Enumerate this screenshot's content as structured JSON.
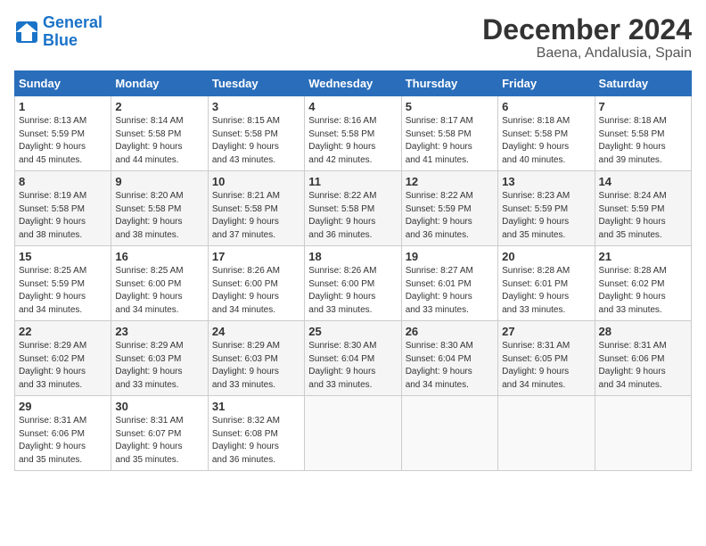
{
  "logo": {
    "line1": "General",
    "line2": "Blue"
  },
  "title": "December 2024",
  "subtitle": "Baena, Andalusia, Spain",
  "days_header": [
    "Sunday",
    "Monday",
    "Tuesday",
    "Wednesday",
    "Thursday",
    "Friday",
    "Saturday"
  ],
  "weeks": [
    [
      {
        "day": "1",
        "info": "Sunrise: 8:13 AM\nSunset: 5:59 PM\nDaylight: 9 hours\nand 45 minutes."
      },
      {
        "day": "2",
        "info": "Sunrise: 8:14 AM\nSunset: 5:58 PM\nDaylight: 9 hours\nand 44 minutes."
      },
      {
        "day": "3",
        "info": "Sunrise: 8:15 AM\nSunset: 5:58 PM\nDaylight: 9 hours\nand 43 minutes."
      },
      {
        "day": "4",
        "info": "Sunrise: 8:16 AM\nSunset: 5:58 PM\nDaylight: 9 hours\nand 42 minutes."
      },
      {
        "day": "5",
        "info": "Sunrise: 8:17 AM\nSunset: 5:58 PM\nDaylight: 9 hours\nand 41 minutes."
      },
      {
        "day": "6",
        "info": "Sunrise: 8:18 AM\nSunset: 5:58 PM\nDaylight: 9 hours\nand 40 minutes."
      },
      {
        "day": "7",
        "info": "Sunrise: 8:18 AM\nSunset: 5:58 PM\nDaylight: 9 hours\nand 39 minutes."
      }
    ],
    [
      {
        "day": "8",
        "info": "Sunrise: 8:19 AM\nSunset: 5:58 PM\nDaylight: 9 hours\nand 38 minutes."
      },
      {
        "day": "9",
        "info": "Sunrise: 8:20 AM\nSunset: 5:58 PM\nDaylight: 9 hours\nand 38 minutes."
      },
      {
        "day": "10",
        "info": "Sunrise: 8:21 AM\nSunset: 5:58 PM\nDaylight: 9 hours\nand 37 minutes."
      },
      {
        "day": "11",
        "info": "Sunrise: 8:22 AM\nSunset: 5:58 PM\nDaylight: 9 hours\nand 36 minutes."
      },
      {
        "day": "12",
        "info": "Sunrise: 8:22 AM\nSunset: 5:59 PM\nDaylight: 9 hours\nand 36 minutes."
      },
      {
        "day": "13",
        "info": "Sunrise: 8:23 AM\nSunset: 5:59 PM\nDaylight: 9 hours\nand 35 minutes."
      },
      {
        "day": "14",
        "info": "Sunrise: 8:24 AM\nSunset: 5:59 PM\nDaylight: 9 hours\nand 35 minutes."
      }
    ],
    [
      {
        "day": "15",
        "info": "Sunrise: 8:25 AM\nSunset: 5:59 PM\nDaylight: 9 hours\nand 34 minutes."
      },
      {
        "day": "16",
        "info": "Sunrise: 8:25 AM\nSunset: 6:00 PM\nDaylight: 9 hours\nand 34 minutes."
      },
      {
        "day": "17",
        "info": "Sunrise: 8:26 AM\nSunset: 6:00 PM\nDaylight: 9 hours\nand 34 minutes."
      },
      {
        "day": "18",
        "info": "Sunrise: 8:26 AM\nSunset: 6:00 PM\nDaylight: 9 hours\nand 33 minutes."
      },
      {
        "day": "19",
        "info": "Sunrise: 8:27 AM\nSunset: 6:01 PM\nDaylight: 9 hours\nand 33 minutes."
      },
      {
        "day": "20",
        "info": "Sunrise: 8:28 AM\nSunset: 6:01 PM\nDaylight: 9 hours\nand 33 minutes."
      },
      {
        "day": "21",
        "info": "Sunrise: 8:28 AM\nSunset: 6:02 PM\nDaylight: 9 hours\nand 33 minutes."
      }
    ],
    [
      {
        "day": "22",
        "info": "Sunrise: 8:29 AM\nSunset: 6:02 PM\nDaylight: 9 hours\nand 33 minutes."
      },
      {
        "day": "23",
        "info": "Sunrise: 8:29 AM\nSunset: 6:03 PM\nDaylight: 9 hours\nand 33 minutes."
      },
      {
        "day": "24",
        "info": "Sunrise: 8:29 AM\nSunset: 6:03 PM\nDaylight: 9 hours\nand 33 minutes."
      },
      {
        "day": "25",
        "info": "Sunrise: 8:30 AM\nSunset: 6:04 PM\nDaylight: 9 hours\nand 33 minutes."
      },
      {
        "day": "26",
        "info": "Sunrise: 8:30 AM\nSunset: 6:04 PM\nDaylight: 9 hours\nand 34 minutes."
      },
      {
        "day": "27",
        "info": "Sunrise: 8:31 AM\nSunset: 6:05 PM\nDaylight: 9 hours\nand 34 minutes."
      },
      {
        "day": "28",
        "info": "Sunrise: 8:31 AM\nSunset: 6:06 PM\nDaylight: 9 hours\nand 34 minutes."
      }
    ],
    [
      {
        "day": "29",
        "info": "Sunrise: 8:31 AM\nSunset: 6:06 PM\nDaylight: 9 hours\nand 35 minutes."
      },
      {
        "day": "30",
        "info": "Sunrise: 8:31 AM\nSunset: 6:07 PM\nDaylight: 9 hours\nand 35 minutes."
      },
      {
        "day": "31",
        "info": "Sunrise: 8:32 AM\nSunset: 6:08 PM\nDaylight: 9 hours\nand 36 minutes."
      },
      null,
      null,
      null,
      null
    ]
  ]
}
